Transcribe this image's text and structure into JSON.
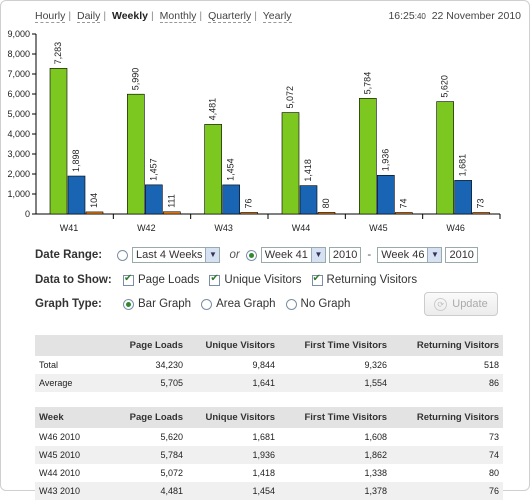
{
  "nav": {
    "periods": [
      "Hourly",
      "Daily",
      "Weekly",
      "Monthly",
      "Quarterly",
      "Yearly"
    ],
    "active": "Weekly"
  },
  "datetime": {
    "time": "16:25",
    "seconds": ":40",
    "date": "22 November 2010"
  },
  "chart_data": {
    "type": "bar",
    "categories": [
      "W41",
      "W42",
      "W43",
      "W44",
      "W45",
      "W46"
    ],
    "series": [
      {
        "values": [
          7283,
          5990,
          4481,
          5072,
          5784,
          5620
        ],
        "color": "#7cc820"
      },
      {
        "values": [
          1898,
          1457,
          1454,
          1418,
          1936,
          1681
        ],
        "color": "#1a64b4"
      },
      {
        "values": [
          104,
          111,
          76,
          80,
          74,
          73
        ],
        "color": "#e87d14"
      }
    ],
    "value_labels": [
      [
        "7,283",
        "5,990",
        "4,481",
        "5,072",
        "5,784",
        "5,620"
      ],
      [
        "1,898",
        "1,457",
        "1,454",
        "1,418",
        "1,936",
        "1,681"
      ],
      [
        "104",
        "111",
        "76",
        "80",
        "74",
        "73"
      ]
    ],
    "ylim": [
      0,
      9000
    ],
    "yticks": [
      "0",
      "1,000",
      "2,000",
      "3,000",
      "4,000",
      "5,000",
      "6,000",
      "7,000",
      "8,000",
      "9,000"
    ],
    "grid": false
  },
  "controls": {
    "date_range_label": "Date Range:",
    "last_weeks_option": "Last 4 Weeks",
    "or_text": "or",
    "from_week": "Week 41",
    "from_year": "2010",
    "dash": "-",
    "to_week": "Week 46",
    "to_year": "2010",
    "data_label": "Data to Show:",
    "page_loads": "Page Loads",
    "unique_visitors": "Unique Visitors",
    "returning_visitors": "Returning Visitors",
    "graph_type_label": "Graph Type:",
    "bar_graph": "Bar Graph",
    "area_graph": "Area Graph",
    "no_graph": "No Graph",
    "update": "Update"
  },
  "summary_table": {
    "headers": [
      "",
      "Page Loads",
      "Unique Visitors",
      "First Time Visitors",
      "Returning Visitors"
    ],
    "rows": [
      [
        "Total",
        "34,230",
        "9,844",
        "9,326",
        "518"
      ],
      [
        "Average",
        "5,705",
        "1,641",
        "1,554",
        "86"
      ]
    ]
  },
  "weekly_table": {
    "headers": [
      "Week",
      "Page Loads",
      "Unique Visitors",
      "First Time Visitors",
      "Returning Visitors"
    ],
    "rows": [
      [
        "W46 2010",
        "5,620",
        "1,681",
        "1,608",
        "73"
      ],
      [
        "W45 2010",
        "5,784",
        "1,936",
        "1,862",
        "74"
      ],
      [
        "W44 2010",
        "5,072",
        "1,418",
        "1,338",
        "80"
      ],
      [
        "W43 2010",
        "4,481",
        "1,454",
        "1,378",
        "76"
      ]
    ]
  }
}
